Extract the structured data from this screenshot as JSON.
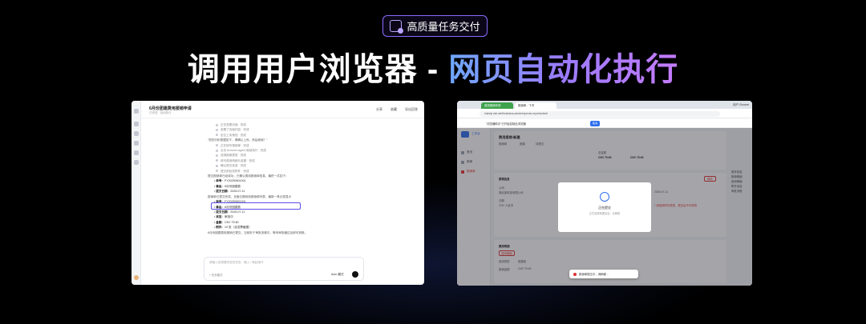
{
  "badge": {
    "icon": "task-delivery-icon",
    "label": "高质量任务交付"
  },
  "headline": {
    "part_a": "调用用户浏览器 - ",
    "part_b": "网页自动化执行"
  },
  "left_app": {
    "title": "6月份团建费用报销申请",
    "subtitle": "已完成 · 自动执行",
    "actions": [
      "分享",
      "收藏",
      "导出回答"
    ],
    "steps": [
      "正在查看页面 · 完成",
      "查看了页面内容 · 完成",
      "定位上传按钮 · 完成",
      "\"您的分析数据如下，请确认上传，然后继续？\"",
      "正在填写报销单 · 完成",
      "点击 browser-agent 继续执行 · 完成",
      "选择报销类型 · 完成",
      "填写费用明细与金额 · 完成",
      "确认提交信息 · 完成",
      "提交前检查附件 · 完成"
    ],
    "intro": "提交报销单已经成功，已确认费用报销单信息，最终一共如下：",
    "fields1": [
      {
        "k": "单号",
        "v": "FY20250601001"
      },
      {
        "k": "事由",
        "v": "6月份团建费"
      },
      {
        "k": "提交日期",
        "v": "2025-07-11"
      }
    ],
    "highlight": "报销单已提交完成，页面已跳转到报销单列表，最新一条记录显示",
    "fields2": [
      {
        "k": "单号",
        "v": "FY20250601001"
      },
      {
        "k": "事由",
        "v": "6月份团建费"
      },
      {
        "k": "提交日期",
        "v": "2025-07-11"
      },
      {
        "k": "状态",
        "v": "审批中"
      },
      {
        "k": "金额",
        "v": "CNY 75.60"
      },
      {
        "k": "附件",
        "v": "10 张（含发票截图）"
      }
    ],
    "closing": "6月份团建费用报销已提交，当前处于审批流程中，等待审批通过后即可到账。",
    "input_placeholder": "请输入您想要完成的任务，输入 / 唤起指令",
    "input_config": "+ 任务模式",
    "model": "Auto 模式"
  },
  "right_app": {
    "tabs": [
      "费用报销申请",
      "报销单 - 飞书"
    ],
    "profile": "用户 Chrome",
    "url": "hubeiyi.ztai.net/t/business-admin/expense-report/submit",
    "infobar_msg": "\"浏览器助手\"已开始控制此浏览器",
    "infobar_btn": "取消",
    "brand": "工作台",
    "nav": [
      "首页",
      "报单",
      "报销单"
    ],
    "page_title": "费用报销-新建",
    "page_tags": [
      "报销单",
      "团建",
      "待提交"
    ],
    "summary": {
      "label": "总金额",
      "amount": "CNY 75.60",
      "paid": "CNY 75.60"
    },
    "right_panel": [
      "基本信息",
      "报销明细",
      "费用明细",
      "附件信息",
      "审批流程"
    ],
    "modal": {
      "icon": "document-icon",
      "title": "正在提交",
      "sub": "正在处理单据信息，请稍候"
    },
    "form": {
      "section1": "报销信息",
      "company": "公司",
      "company_val": "湖北某科技有限公司",
      "date_label": "日期",
      "date_val": "2025-07-11",
      "currency": "CNY 人民币",
      "remark_red": "* 请选择附件类型，提交后不可修改",
      "edit_btn": "修改",
      "section2": "费用明细",
      "detail_tag": "费用明细",
      "type_label": "费用类型",
      "type_val": "团建费",
      "amount_label": "报销金额",
      "amount_val": "CNY 75.60"
    },
    "toast": "报销单提交中，请稍候..."
  }
}
